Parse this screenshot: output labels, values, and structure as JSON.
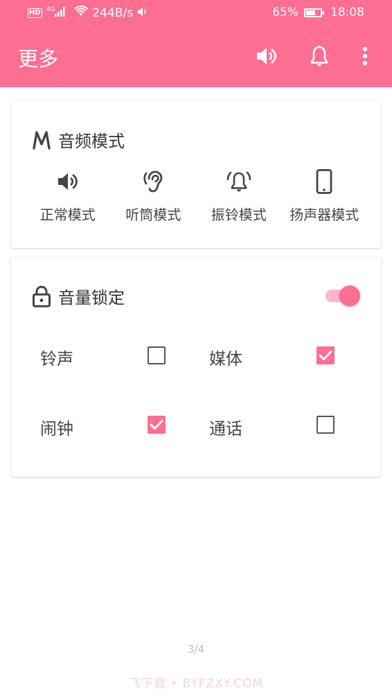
{
  "status_bar": {
    "network_badge": "HD",
    "signal_label": "4G",
    "speed": "244B/s",
    "battery_pct": "65%",
    "battery_level": 0.65,
    "time": "18:08"
  },
  "app_bar": {
    "title": "更多",
    "icons": [
      "volume-icon",
      "bell-icon",
      "more-vert-icon"
    ],
    "color": "#ff6e93"
  },
  "audio_mode": {
    "title": "音频模式",
    "title_icon": "m-letter-icon",
    "modes": [
      {
        "label": "正常模式",
        "icon": "speaker-icon"
      },
      {
        "label": "听筒模式",
        "icon": "ear-icon"
      },
      {
        "label": "振铃模式",
        "icon": "ringing-bell-icon"
      },
      {
        "label": "扬声器模式",
        "icon": "phone-icon"
      }
    ]
  },
  "volume_lock": {
    "title": "音量锁定",
    "title_icon": "lock-icon",
    "enabled": true,
    "options": [
      {
        "label": "铃声",
        "checked": false
      },
      {
        "label": "媒体",
        "checked": true
      },
      {
        "label": "闹钟",
        "checked": true
      },
      {
        "label": "通话",
        "checked": false
      }
    ]
  },
  "page_indicator": "3/4",
  "watermark": "飞下载 • BYFZXY.COM",
  "accent_color": "#ff6e93"
}
